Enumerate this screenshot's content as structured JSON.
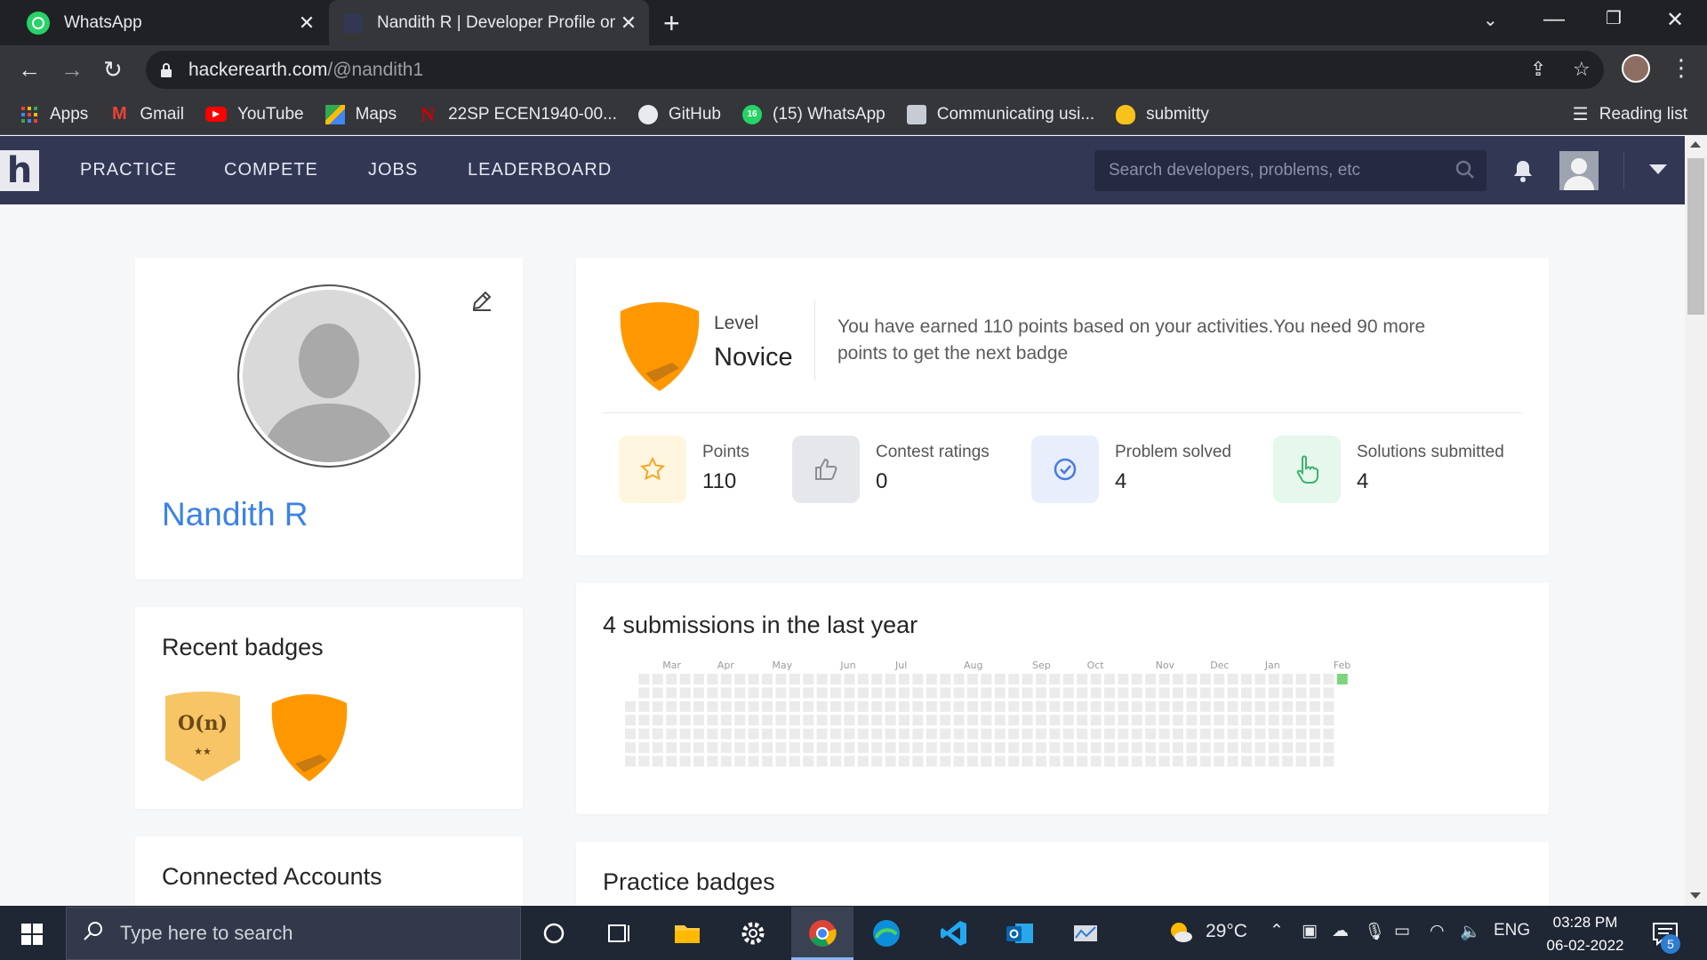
{
  "browser": {
    "tabs": [
      {
        "title": "WhatsApp",
        "active": false,
        "icon": "whatsapp-icon"
      },
      {
        "title": "Nandith R | Developer Profile on",
        "active": true,
        "icon": "hackerearth-favicon"
      }
    ],
    "url_host": "hackerearth.com",
    "url_path": "/@nandith1",
    "bookmarks": [
      {
        "label": "Apps",
        "icon": "apps-grid-icon"
      },
      {
        "label": "Gmail",
        "icon": "gmail-icon"
      },
      {
        "label": "YouTube",
        "icon": "youtube-icon"
      },
      {
        "label": "Maps",
        "icon": "maps-icon"
      },
      {
        "label": "22SP ECEN1940-00...",
        "icon": "nebraska-icon"
      },
      {
        "label": "GitHub",
        "icon": "github-icon"
      },
      {
        "label": "(15) WhatsApp",
        "icon": "whatsapp-icon"
      },
      {
        "label": "Communicating usi...",
        "icon": "page-icon"
      },
      {
        "label": "submitty",
        "icon": "duck-icon"
      }
    ],
    "reading_list": "Reading list"
  },
  "site": {
    "logo": "h",
    "nav": [
      "PRACTICE",
      "COMPETE",
      "JOBS",
      "LEADERBOARD"
    ],
    "search_placeholder": "Search developers, problems, etc"
  },
  "profile": {
    "name": "Nandith R"
  },
  "level": {
    "label": "Level",
    "name": "Novice",
    "message": "You have earned 110 points based on your activities.You need 90 more points to get the next badge",
    "stats": [
      {
        "label": "Points",
        "value": "110",
        "icon": "star-icon",
        "bg": "#fff6e0",
        "color": "#f5a623"
      },
      {
        "label": "Contest ratings",
        "value": "0",
        "icon": "thumbs-up-icon",
        "bg": "#e6e7ea",
        "color": "#8a8d93"
      },
      {
        "label": "Problem solved",
        "value": "4",
        "icon": "check-circle-icon",
        "bg": "#e8eefc",
        "color": "#4a7ae0"
      },
      {
        "label": "Solutions submitted",
        "value": "4",
        "icon": "pointer-hand-icon",
        "bg": "#e6f7ec",
        "color": "#3cb371"
      }
    ]
  },
  "badges": {
    "title": "Recent badges",
    "items": [
      {
        "text": "O(n)",
        "stars": "★★",
        "color": "#f7c466"
      },
      {
        "text": "",
        "stars": "",
        "color": "#ff9800"
      }
    ]
  },
  "accounts": {
    "title": "Connected Accounts"
  },
  "submissions": {
    "title": "4 submissions in the last year",
    "months": [
      "Mar",
      "Apr",
      "May",
      "Jun",
      "Jul",
      "Aug",
      "Sep",
      "Oct",
      "Nov",
      "Dec",
      "Jan",
      "Feb"
    ],
    "weeks": 53,
    "active_cell": {
      "week": 52,
      "day": 0,
      "color": "#7bd67b"
    },
    "empty_color": "#ebebeb"
  },
  "practice": {
    "title": "Practice badges"
  },
  "taskbar": {
    "search_placeholder": "Type here to search",
    "weather": "29°C",
    "lang": "ENG",
    "time": "03:28 PM",
    "date": "06-02-2022",
    "notifications": "5"
  }
}
